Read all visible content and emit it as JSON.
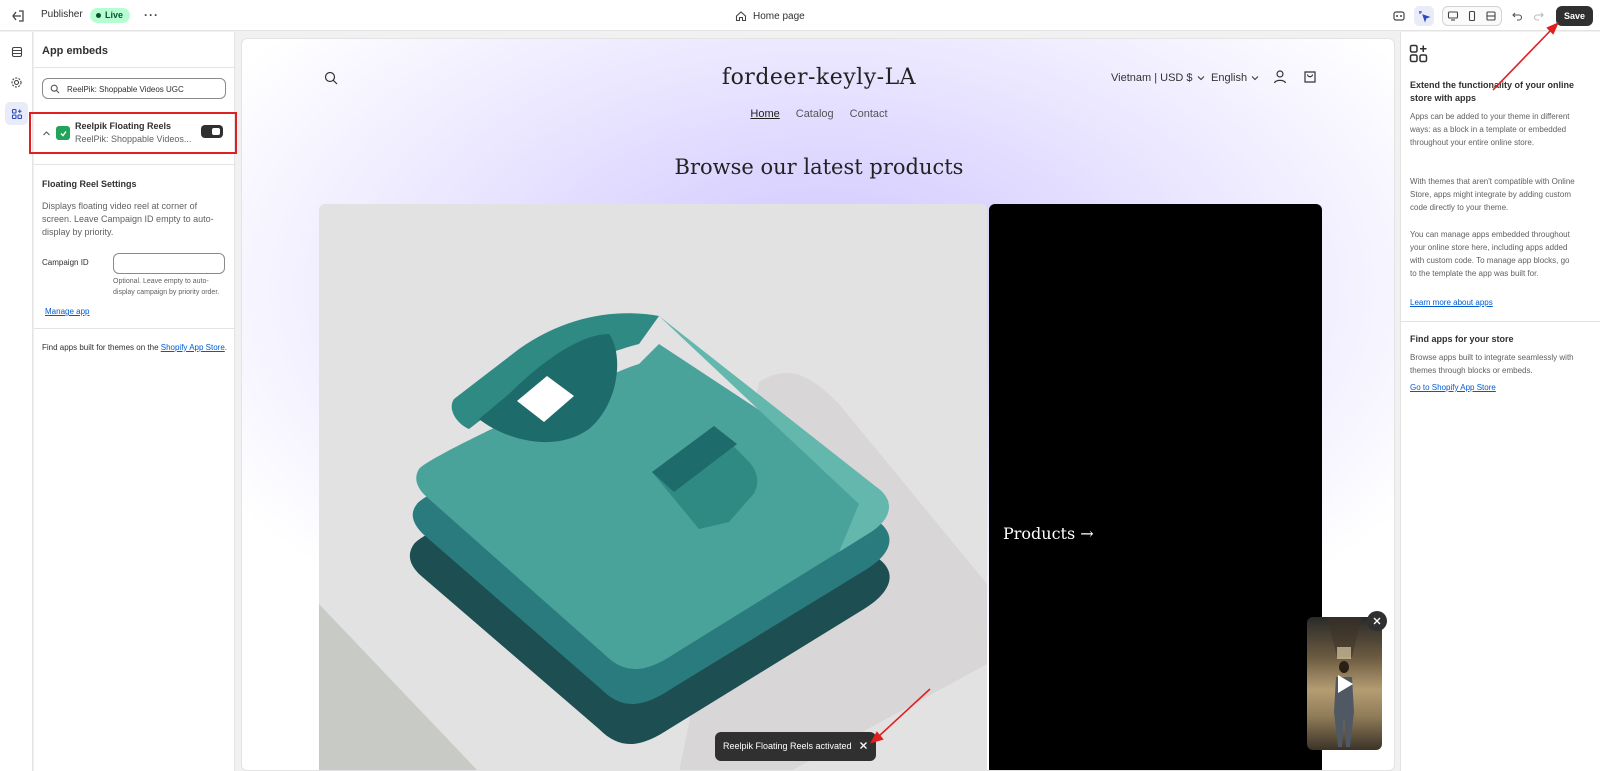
{
  "topbar": {
    "title": "Publisher",
    "status": "Live",
    "page": "Home page",
    "save_label": "Save"
  },
  "left_panel": {
    "title": "App embeds",
    "search_value": "ReelPik: Shoppable Videos UGC",
    "embed": {
      "name": "Reelpik Floating Reels",
      "subtitle": "ReelPik: Shoppable Videos...",
      "enabled": true
    },
    "settings_title": "Floating Reel Settings",
    "settings_desc": "Displays floating video reel at corner of screen. Leave Campaign ID empty to auto-display by priority.",
    "campaign_label": "Campaign ID",
    "campaign_value": "",
    "campaign_help": "Optional. Leave empty to auto-display campaign by priority order.",
    "manage_link": "Manage app",
    "find_prefix": "Find apps built for themes on the ",
    "find_link": "Shopify App Store",
    "find_suffix": "."
  },
  "preview": {
    "store_name": "fordeer-keyly-LA",
    "nav": [
      "Home",
      "Catalog",
      "Contact"
    ],
    "locale": "Vietnam | USD $",
    "language": "English",
    "section_title": "Browse our latest products",
    "products_tile": "Products →",
    "toast": "Reelpik Floating Reels activated"
  },
  "right_panel": {
    "heading1": "Extend the functionality of your online store with apps",
    "p1": "Apps can be added to your theme in different ways: as a block in a template or embedded throughout your entire online store.",
    "p2": "With themes that aren't compatible with Online Store, apps might integrate by adding custom code directly to your theme.",
    "p3": "You can manage apps embedded throughout your online store here, including apps added with custom code. To manage app blocks, go to the template the app was built for.",
    "link1": "Learn more about apps",
    "heading2": "Find apps for your store",
    "p4": "Browse apps built to integrate seamlessly with themes through blocks or embeds.",
    "link2": "Go to Shopify App Store"
  },
  "colors": {
    "accent": "#005bd3",
    "highlight_box": "#e02020",
    "dark": "#303030",
    "live_bg": "#b4fed2"
  }
}
